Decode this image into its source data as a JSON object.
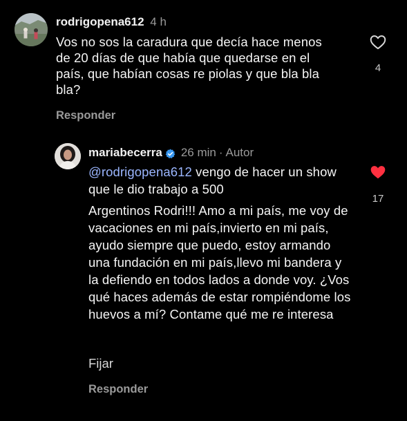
{
  "comments": [
    {
      "username": "rodrigopena612",
      "time": "4 h",
      "text": "Vos no sos la caradura que decía hace menos de 20 días de que había que quedarse en el país, que habían cosas re piolas y que bla bla bla?",
      "reply_label": "Responder",
      "like_icon": "heart-outline-icon",
      "likes": "4",
      "liked": false
    },
    {
      "username": "mariabecerra",
      "verified": true,
      "time": "26 min",
      "separator": "·",
      "author_tag": "Autor",
      "mention": "@rodrigopena612",
      "text_line1": " vengo de hacer un show que le dio trabajo a 500",
      "text_rest": "Argentinos Rodri!!! Amo a mi país, me voy de vacaciones en mi país,invierto en mi país, ayudo siempre que puedo, estoy armando una fundación en mi país,llevo mi bandera y la defiendo en todos lados a donde voy. ¿Vos qué haces además de estar rompiéndome los huevos a mí? Contame qué me re interesa",
      "pin_label": "Fijar",
      "reply_label": "Responder",
      "like_icon": "heart-filled-icon",
      "likes": "17",
      "liked": true,
      "like_color": "#ff3040"
    }
  ]
}
